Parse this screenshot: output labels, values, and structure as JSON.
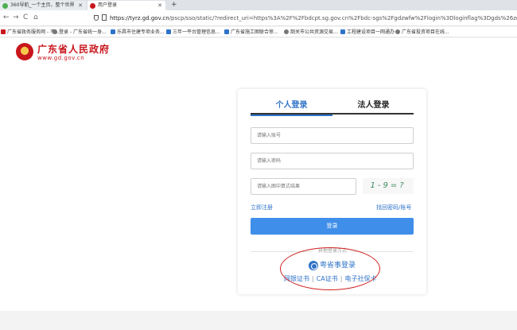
{
  "browser": {
    "tabs": [
      {
        "label": "360导航_一个主页，整个世界",
        "favicon_color": "#4caf50"
      },
      {
        "label": "用户登录",
        "favicon_color": "#c8161d"
      }
    ],
    "new_tab": "+",
    "nav": {
      "back": "←",
      "forward": "→",
      "reload": "C",
      "home": "⌂"
    },
    "address": {
      "host": "https://tyrz.gd.gov.cn",
      "path": "/pscp/sso/static/?redirect_uri=https%3A%2F%2Fbdcpt.sg.gov.cn%2Fbdc-sgs%2Fgdzwfw%2Flogin%3Dloginflag%3Dgds%26zdredirect%3DaHR0cHM6Ly9"
    },
    "bookmarks": [
      {
        "label": "广东省政务服务网 - 不...",
        "color": "#c8161d"
      },
      {
        "label": "登录 - 广东省统一身...",
        "color": "#777777"
      },
      {
        "label": "乐昌市住建专项业务...",
        "color": "#2f73c7"
      },
      {
        "label": "三年一平台管理信息...",
        "color": "#2f73c7"
      },
      {
        "label": "广东省施工图联合审...",
        "color": "#2f73c7"
      },
      {
        "label": "韶关市公共资源交易...",
        "color": "#777777"
      },
      {
        "label": "工程建设项目一网通办",
        "color": "#2f73c7"
      },
      {
        "label": "广东省投资项目在线...",
        "color": "#777777"
      }
    ]
  },
  "header": {
    "title": "广东省人民政府",
    "url": "www.gd.gov.cn"
  },
  "login": {
    "tab_personal": "个人登录",
    "tab_legal": "法人登录",
    "account_placeholder": "请输入账号",
    "password_placeholder": "请输入密码",
    "captcha_placeholder": "请输入图中算式结果",
    "captcha_text": "1-9=?",
    "register": "立即注册",
    "forgot": "找回密码/账号",
    "submit": "登录",
    "other_methods": "其他登录方式",
    "yue_login": "粤省事登录",
    "alt_methods": [
      "网银证书",
      "CA证书",
      "电子社保卡"
    ],
    "alt_sep": "|"
  },
  "colors": {
    "brand_red": "#c8161d",
    "accent_blue": "#2f73c7",
    "button_blue": "#3f8ee9",
    "annotation_red": "#d12020"
  }
}
